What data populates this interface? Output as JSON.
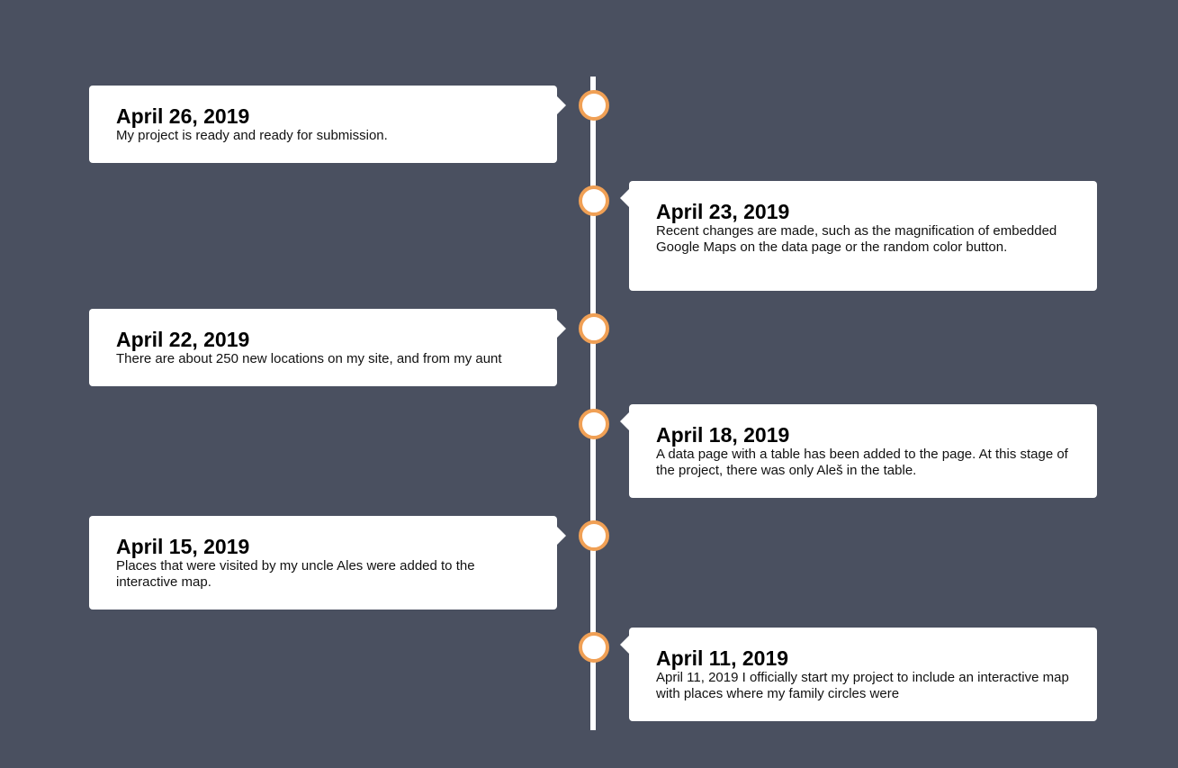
{
  "colors": {
    "background": "#4a5060",
    "line": "#ffffff",
    "dot_border": "#f0a055",
    "card": "#ffffff"
  },
  "timeline": {
    "entries": [
      {
        "side": "left",
        "date": "April 26, 2019",
        "text": "My project is ready and ready for submission."
      },
      {
        "side": "right",
        "date": "April 23, 2019",
        "text": "Recent changes are made, such as the magnification of embedded Google Maps on the data page or the random color button."
      },
      {
        "side": "left",
        "date": "April 22, 2019",
        "text": "There are about 250 new locations on my site, and from my aunt"
      },
      {
        "side": "right",
        "date": "April 18, 2019",
        "text": "A data page with a table has been added to the page. At this stage of the project, there was only Aleš in the table."
      },
      {
        "side": "left",
        "date": "April 15, 2019",
        "text": "Places that were visited by my uncle Ales were added to the interactive map."
      },
      {
        "side": "right",
        "date": "April 11, 2019",
        "text": "April 11, 2019 I officially start my project to include an interactive map with places where my family circles were"
      }
    ]
  }
}
